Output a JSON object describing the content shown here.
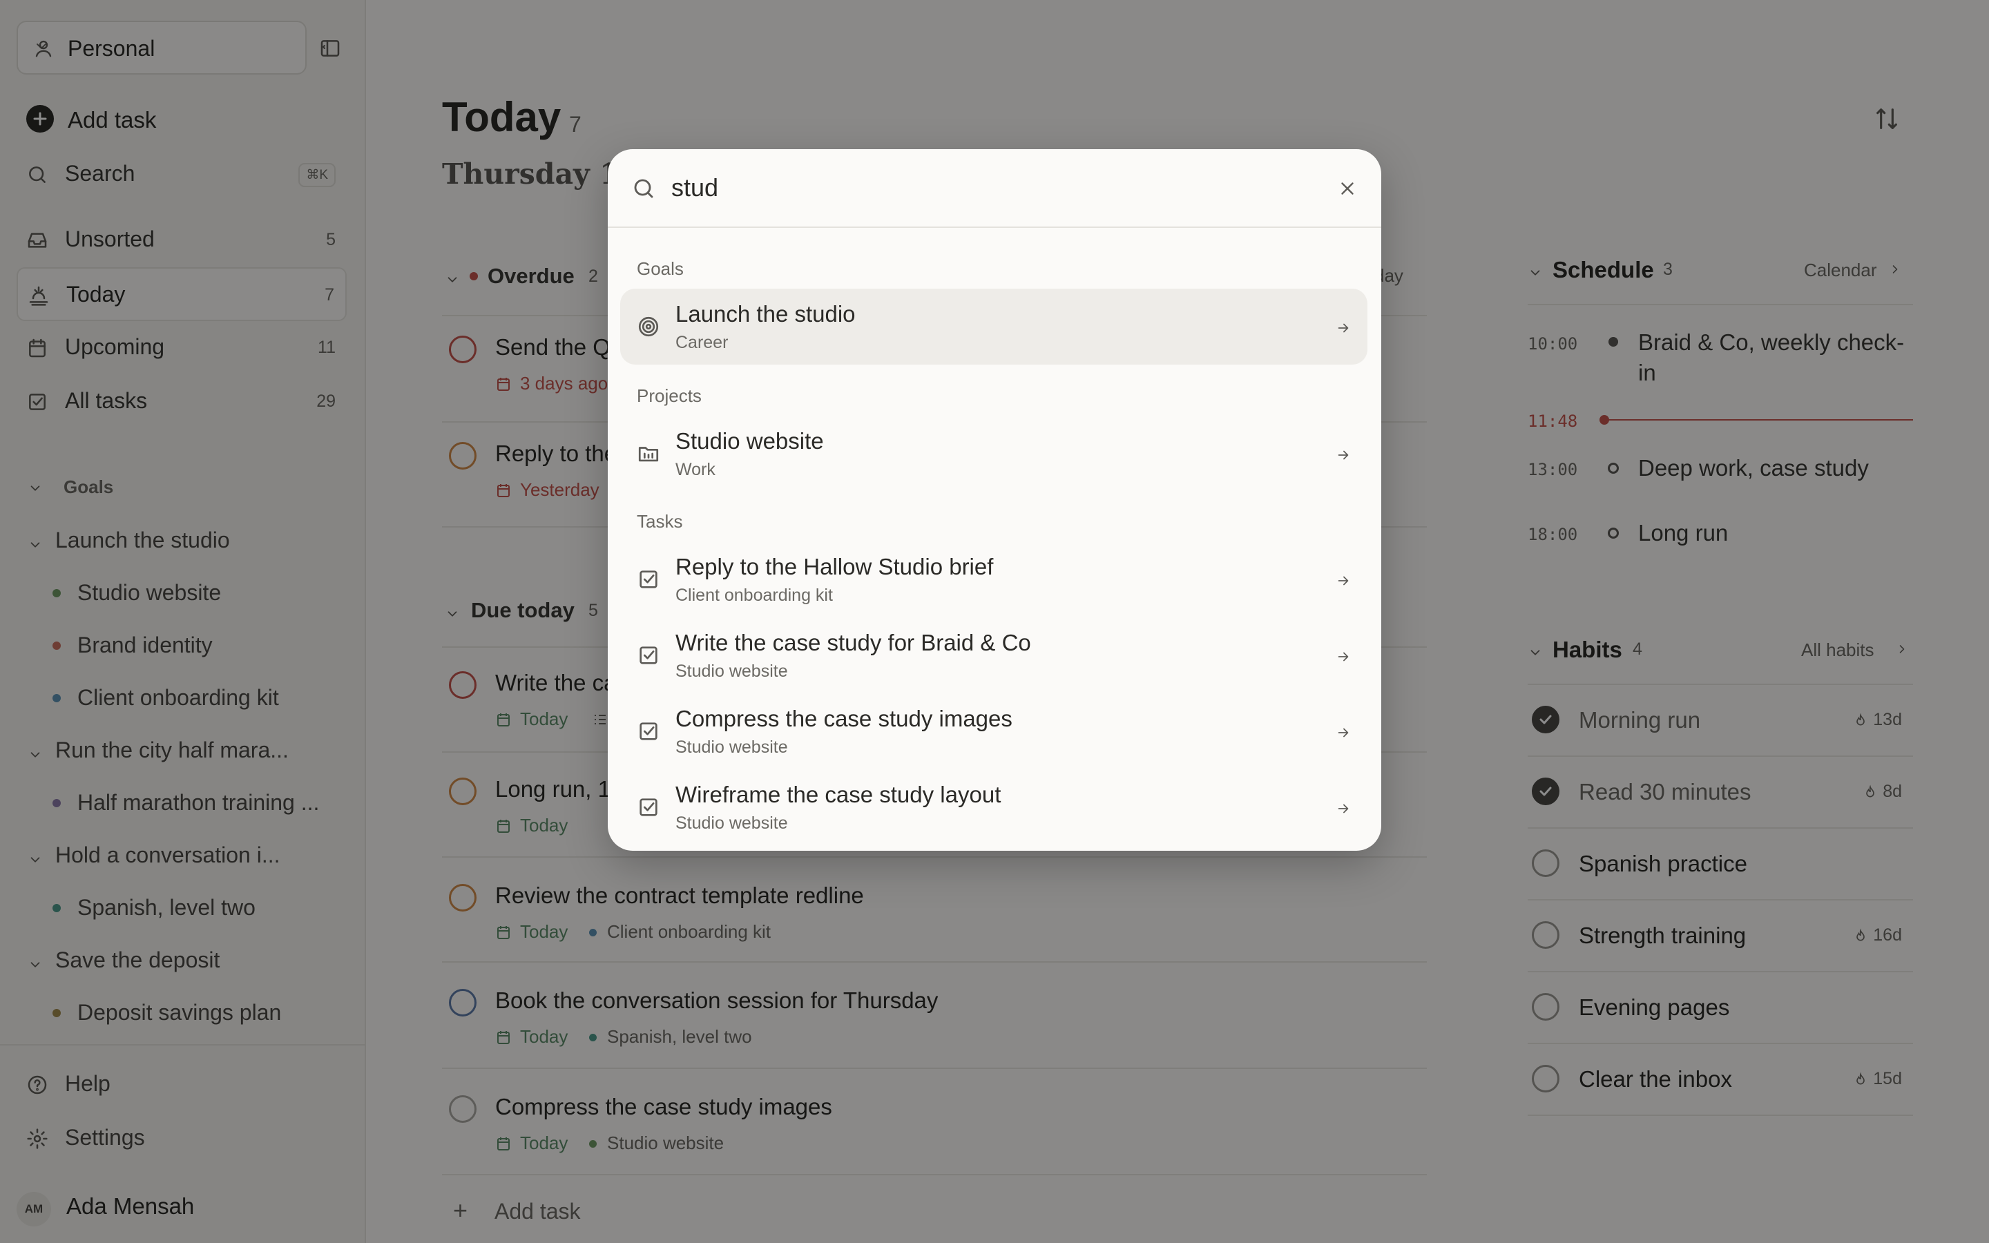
{
  "sidebar": {
    "workspace": "Personal",
    "add_task": "Add task",
    "search": {
      "label": "Search",
      "shortcut": "⌘K"
    },
    "nav": [
      {
        "label": "Unsorted",
        "count": "5",
        "icon": "inbox-icon"
      },
      {
        "label": "Today",
        "count": "7",
        "icon": "sunrise-icon",
        "active": true
      },
      {
        "label": "Upcoming",
        "count": "11",
        "icon": "calendar-icon"
      },
      {
        "label": "All tasks",
        "count": "29",
        "icon": "checkbox-icon"
      }
    ],
    "goals_label": "Goals",
    "goals": [
      {
        "name": "Launch the studio",
        "projects": [
          {
            "name": "Studio website",
            "color": "#6f9a64"
          },
          {
            "name": "Brand identity",
            "color": "#c9705f"
          },
          {
            "name": "Client onboarding kit",
            "color": "#5d93b5"
          }
        ]
      },
      {
        "name": "Run the city half mara...",
        "projects": [
          {
            "name": "Half marathon training ...",
            "color": "#8a7aaa"
          }
        ]
      },
      {
        "name": "Hold a conversation i...",
        "projects": [
          {
            "name": "Spanish, level two",
            "color": "#4d9a8a"
          }
        ]
      },
      {
        "name": "Save the deposit",
        "projects": [
          {
            "name": "Deposit savings plan",
            "color": "#a08a4d"
          }
        ]
      }
    ],
    "help": "Help",
    "settings": "Settings",
    "user": {
      "initials": "AM",
      "name": "Ada Mensah"
    }
  },
  "main": {
    "title": "Today",
    "title_count": "7",
    "date": "Thursday 10",
    "overdue": {
      "label": "Overdue",
      "count": "2",
      "reschedule": "day",
      "tasks": [
        {
          "title": "Send the Q",
          "date": "3 days ago",
          "ring": "#c4544d"
        },
        {
          "title": "Reply to the",
          "date": "Yesterday",
          "ring": "#d08a4a"
        }
      ]
    },
    "due_today": {
      "label": "Due today",
      "count": "5",
      "tasks": [
        {
          "title": "Write the ca",
          "date": "Today",
          "project": "",
          "ring": "#c4544d",
          "pdot": ""
        },
        {
          "title": "Long run, 1",
          "date": "Today",
          "project": "",
          "ring": "#d08a4a",
          "pdot": ""
        },
        {
          "title": "Review the contract template redline",
          "date": "Today",
          "project": "Client onboarding kit",
          "ring": "#d08a4a",
          "pdot": "#5d93b5"
        },
        {
          "title": "Book the conversation session for Thursday",
          "date": "Today",
          "project": "Spanish, level two",
          "ring": "#5d7aa8",
          "pdot": "#4d9a8a"
        },
        {
          "title": "Compress the case study images",
          "date": "Today",
          "project": "Studio website",
          "ring": "#aaa8a3",
          "pdot": "#6f9a64"
        }
      ]
    },
    "add_task": "Add task"
  },
  "schedule": {
    "label": "Schedule",
    "count": "3",
    "link": "Calendar",
    "now_time": "11:48",
    "events": [
      {
        "time": "10:00",
        "title": "Braid & Co, weekly check-in"
      },
      {
        "time": "13:00",
        "title": "Deep work, case study"
      },
      {
        "time": "18:00",
        "title": "Long run"
      }
    ]
  },
  "habits": {
    "label": "Habits",
    "count": "4",
    "link": "All habits",
    "items": [
      {
        "name": "Morning run",
        "streak": "13d",
        "done": true
      },
      {
        "name": "Read 30 minutes",
        "streak": "8d",
        "done": true
      },
      {
        "name": "Spanish practice",
        "streak": "",
        "done": false
      },
      {
        "name": "Strength training",
        "streak": "16d",
        "done": false
      },
      {
        "name": "Evening pages",
        "streak": "",
        "done": false
      },
      {
        "name": "Clear the inbox",
        "streak": "15d",
        "done": false
      }
    ]
  },
  "palette": {
    "query": "stud",
    "sections": {
      "goals": "Goals",
      "projects": "Projects",
      "tasks": "Tasks"
    },
    "goals": [
      {
        "title": "Launch the studio",
        "subtitle": "Career",
        "icon": "target-icon"
      }
    ],
    "projects": [
      {
        "title": "Studio website",
        "subtitle": "Work",
        "icon": "folder-icon"
      }
    ],
    "tasks": [
      {
        "title": "Reply to the Hallow Studio brief",
        "subtitle": "Client onboarding kit",
        "icon": "checkbox-icon"
      },
      {
        "title": "Write the case study for Braid & Co",
        "subtitle": "Studio website",
        "icon": "checkbox-icon"
      },
      {
        "title": "Compress the case study images",
        "subtitle": "Studio website",
        "icon": "checkbox-icon"
      },
      {
        "title": "Wireframe the case study layout",
        "subtitle": "Studio website",
        "icon": "checkbox-icon"
      }
    ]
  }
}
